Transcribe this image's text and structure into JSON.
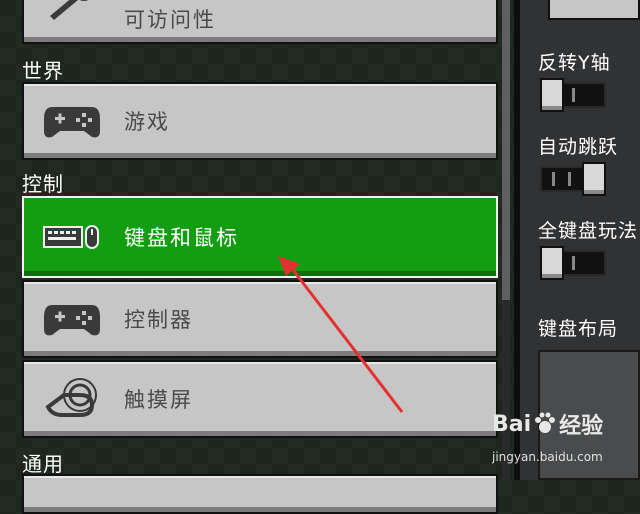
{
  "nav": {
    "top_item": {
      "label": "可访问性",
      "icon": "wrench-icon"
    },
    "sections": [
      {
        "title": "世界"
      },
      {
        "title": "控制"
      },
      {
        "title": "通用"
      }
    ],
    "items": [
      {
        "label": "游戏",
        "icon": "gamepad-icon",
        "selected": false
      },
      {
        "label": "键盘和鼠标",
        "icon": "keyboard-mouse-icon",
        "selected": true
      },
      {
        "label": "控制器",
        "icon": "controller-icon",
        "selected": false
      },
      {
        "label": "触摸屏",
        "icon": "touch-hand-icon",
        "selected": false
      }
    ]
  },
  "settings": {
    "invert_y": {
      "label": "反转Y轴",
      "on": false
    },
    "auto_jump": {
      "label": "自动跳跃",
      "on": true
    },
    "full_keyboard": {
      "label": "全键盘玩法",
      "on": false
    },
    "keyboard_layout": {
      "label": "键盘布局"
    }
  },
  "watermark": {
    "brand": "Bai",
    "brand2": "经验",
    "url": "jingyan.baidu.com"
  },
  "colors": {
    "selected_green": "#139e12",
    "button_gray": "#c6c6c6",
    "arrow_red": "#e53030"
  }
}
